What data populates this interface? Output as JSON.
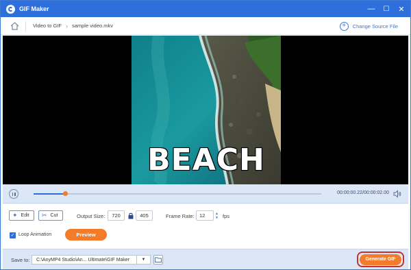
{
  "window": {
    "title": "GIF Maker",
    "controls": {
      "minimize": "—",
      "maximize": "☐",
      "close": "✕"
    }
  },
  "breadcrumb": {
    "items": [
      "Video to GIF",
      "sample video.mkv"
    ],
    "change_source": "Change Source File"
  },
  "video": {
    "caption": "BEACH"
  },
  "player": {
    "progress": 0.11,
    "timecode": "00:00:00.22/00:00:02.00"
  },
  "edit": {
    "edit_label": "Edit",
    "cut_label": "Cut",
    "output_size_label": "Output Size:",
    "width": "720",
    "height": "405",
    "frame_rate_label": "Frame Rate:",
    "frame_rate": "12",
    "fps_label": "fps",
    "loop_label": "Loop Animation",
    "loop_checked": true,
    "preview_label": "Preview"
  },
  "save": {
    "label": "Save to:",
    "path": "C:\\AnyMP4 Studio\\An... Ultimate\\GIF Maker",
    "generate_label": "Generate GIF"
  },
  "colors": {
    "accent": "#2e6fdb",
    "orange": "#f47b2a",
    "highlight": "#c9302c"
  }
}
